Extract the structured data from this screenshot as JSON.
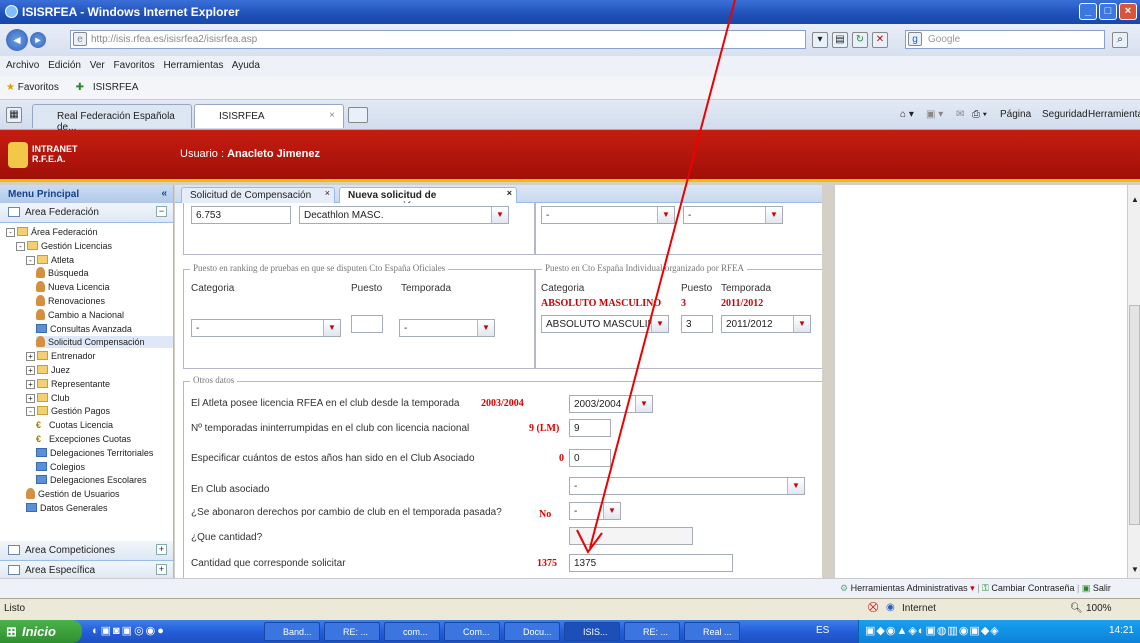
{
  "window": {
    "title": "ISISRFEA - Windows Internet Explorer"
  },
  "address": {
    "url": "http://isis.rfea.es/isisrfea2/isisrfea.asp",
    "search_placeholder": "Google"
  },
  "menubar": {
    "items": [
      "Archivo",
      "Edición",
      "Ver",
      "Favoritos",
      "Herramientas",
      "Ayuda"
    ]
  },
  "favorites": {
    "label": "Favoritos",
    "link": "ISISRFEA"
  },
  "browser_tabs": [
    {
      "label": "Real Federación Española de..."
    },
    {
      "label": "ISISRFEA"
    }
  ],
  "command_bar": {
    "page": "Página",
    "security": "Seguridad",
    "tools": "Herramientas"
  },
  "header": {
    "logo_line1": "INTRANET",
    "logo_line2": "R.F.E.A.",
    "user_prefix": "Usuario :",
    "user_name": "Anacleto Jimenez"
  },
  "sidebar": {
    "title": "Menu Principal",
    "area_federacion": "Area Federación",
    "tree": [
      {
        "label": "Área Federación",
        "level": 0,
        "icon": "folder"
      },
      {
        "label": "Gestión Licencias",
        "level": 1,
        "icon": "folder"
      },
      {
        "label": "Atleta",
        "level": 2,
        "icon": "folder"
      },
      {
        "label": "Búsqueda",
        "level": 3,
        "icon": "person"
      },
      {
        "label": "Nueva Licencia",
        "level": 3,
        "icon": "person"
      },
      {
        "label": "Renovaciones",
        "level": 3,
        "icon": "person"
      },
      {
        "label": "Cambio a Nacional",
        "level": 3,
        "icon": "person"
      },
      {
        "label": "Consultas Avanzada",
        "level": 3,
        "icon": "grid"
      },
      {
        "label": "Solicitud Compensación",
        "level": 3,
        "icon": "person",
        "selected": true
      },
      {
        "label": "Entrenador",
        "level": 2,
        "icon": "folder"
      },
      {
        "label": "Juez",
        "level": 2,
        "icon": "folder"
      },
      {
        "label": "Representante",
        "level": 2,
        "icon": "folder"
      },
      {
        "label": "Club",
        "level": 2,
        "icon": "folder"
      },
      {
        "label": "Gestión Pagos",
        "level": 2,
        "icon": "folder"
      },
      {
        "label": "Cuotas Licencia",
        "level": 3,
        "icon": "euro"
      },
      {
        "label": "Excepciones Cuotas",
        "level": 3,
        "icon": "euro"
      },
      {
        "label": "Delegaciones Territoriales",
        "level": 3,
        "icon": "grid"
      },
      {
        "label": "Colegios",
        "level": 3,
        "icon": "grid"
      },
      {
        "label": "Delegaciones Escolares",
        "level": 3,
        "icon": "grid"
      },
      {
        "label": "Gestión de Usuarios",
        "level": 2,
        "icon": "person"
      },
      {
        "label": "Datos Generales",
        "level": 2,
        "icon": "grid"
      }
    ],
    "area_competiciones": "Area Competiciones",
    "area_especifica": "Area Específica"
  },
  "content_tabs": [
    {
      "label": "Solicitud de Compensación"
    },
    {
      "label": "Nueva solicitud de compensación"
    }
  ],
  "form": {
    "top_points": "6.753",
    "top_prueba": "Decathlon MASC.",
    "top_combo_a": "-",
    "top_combo_b": "-",
    "ranking_legend": "Puesto en ranking de pruebas en que se disputen Cto España Oficiales",
    "cto_legend": "Puesto en Cto España Individual organizado por RFEA",
    "col_categoria": "Categoria",
    "col_puesto": "Puesto",
    "col_temporada": "Temporada",
    "rank_categoria": "-",
    "rank_puesto": "",
    "rank_temporada": "-",
    "cto_categoria_red": "ABSOLUTO MASCULINO",
    "cto_puesto_red": "3",
    "cto_temporada_red": "2011/2012",
    "cto_categoria": "ABSOLUTO MASCULINO",
    "cto_puesto": "3",
    "cto_temporada": "2011/2012",
    "otros_legend": "Otros datos",
    "rows": [
      {
        "label": "El Atleta posee licencia RFEA en el club desde la temporada",
        "red": "2003/2004",
        "value": "2003/2004"
      },
      {
        "label": "Nº temporadas ininterrumpidas en el club con licencia nacional",
        "red": "9 (LM)",
        "value": "9"
      },
      {
        "label": "Especificar cuántos de estos años han sido en el Club Asociado",
        "red": "0",
        "value": "0"
      },
      {
        "label": "En Club asociado",
        "red": "",
        "value": "-"
      },
      {
        "label": "¿Se abonaron derechos por cambio de club en el temporada pasada?",
        "red": "No",
        "value": "-"
      },
      {
        "label": "¿Que cantidad?",
        "red": "",
        "value": ""
      },
      {
        "label": "Cantidad que corresponde solicitar",
        "red": "1375",
        "value": "1375"
      }
    ]
  },
  "admin_bar": {
    "tools": "Herramientas Administrativas",
    "change_password": "Cambiar Contraseña",
    "exit": "Salir"
  },
  "status": {
    "left": "Listo",
    "zone": "Internet",
    "zoom": "100%"
  },
  "taskbar": {
    "start": "Inicio",
    "items": [
      "Band...",
      "RE: ...",
      "com...",
      "Com...",
      "Docu...",
      "ISIS...",
      "RE: ...",
      "Real ..."
    ],
    "lang": "ES",
    "clock": "14:21"
  },
  "colors": {
    "header_red": "#b01408",
    "value_red": "#dd0000",
    "annotation_arrow": "#ee0000"
  }
}
